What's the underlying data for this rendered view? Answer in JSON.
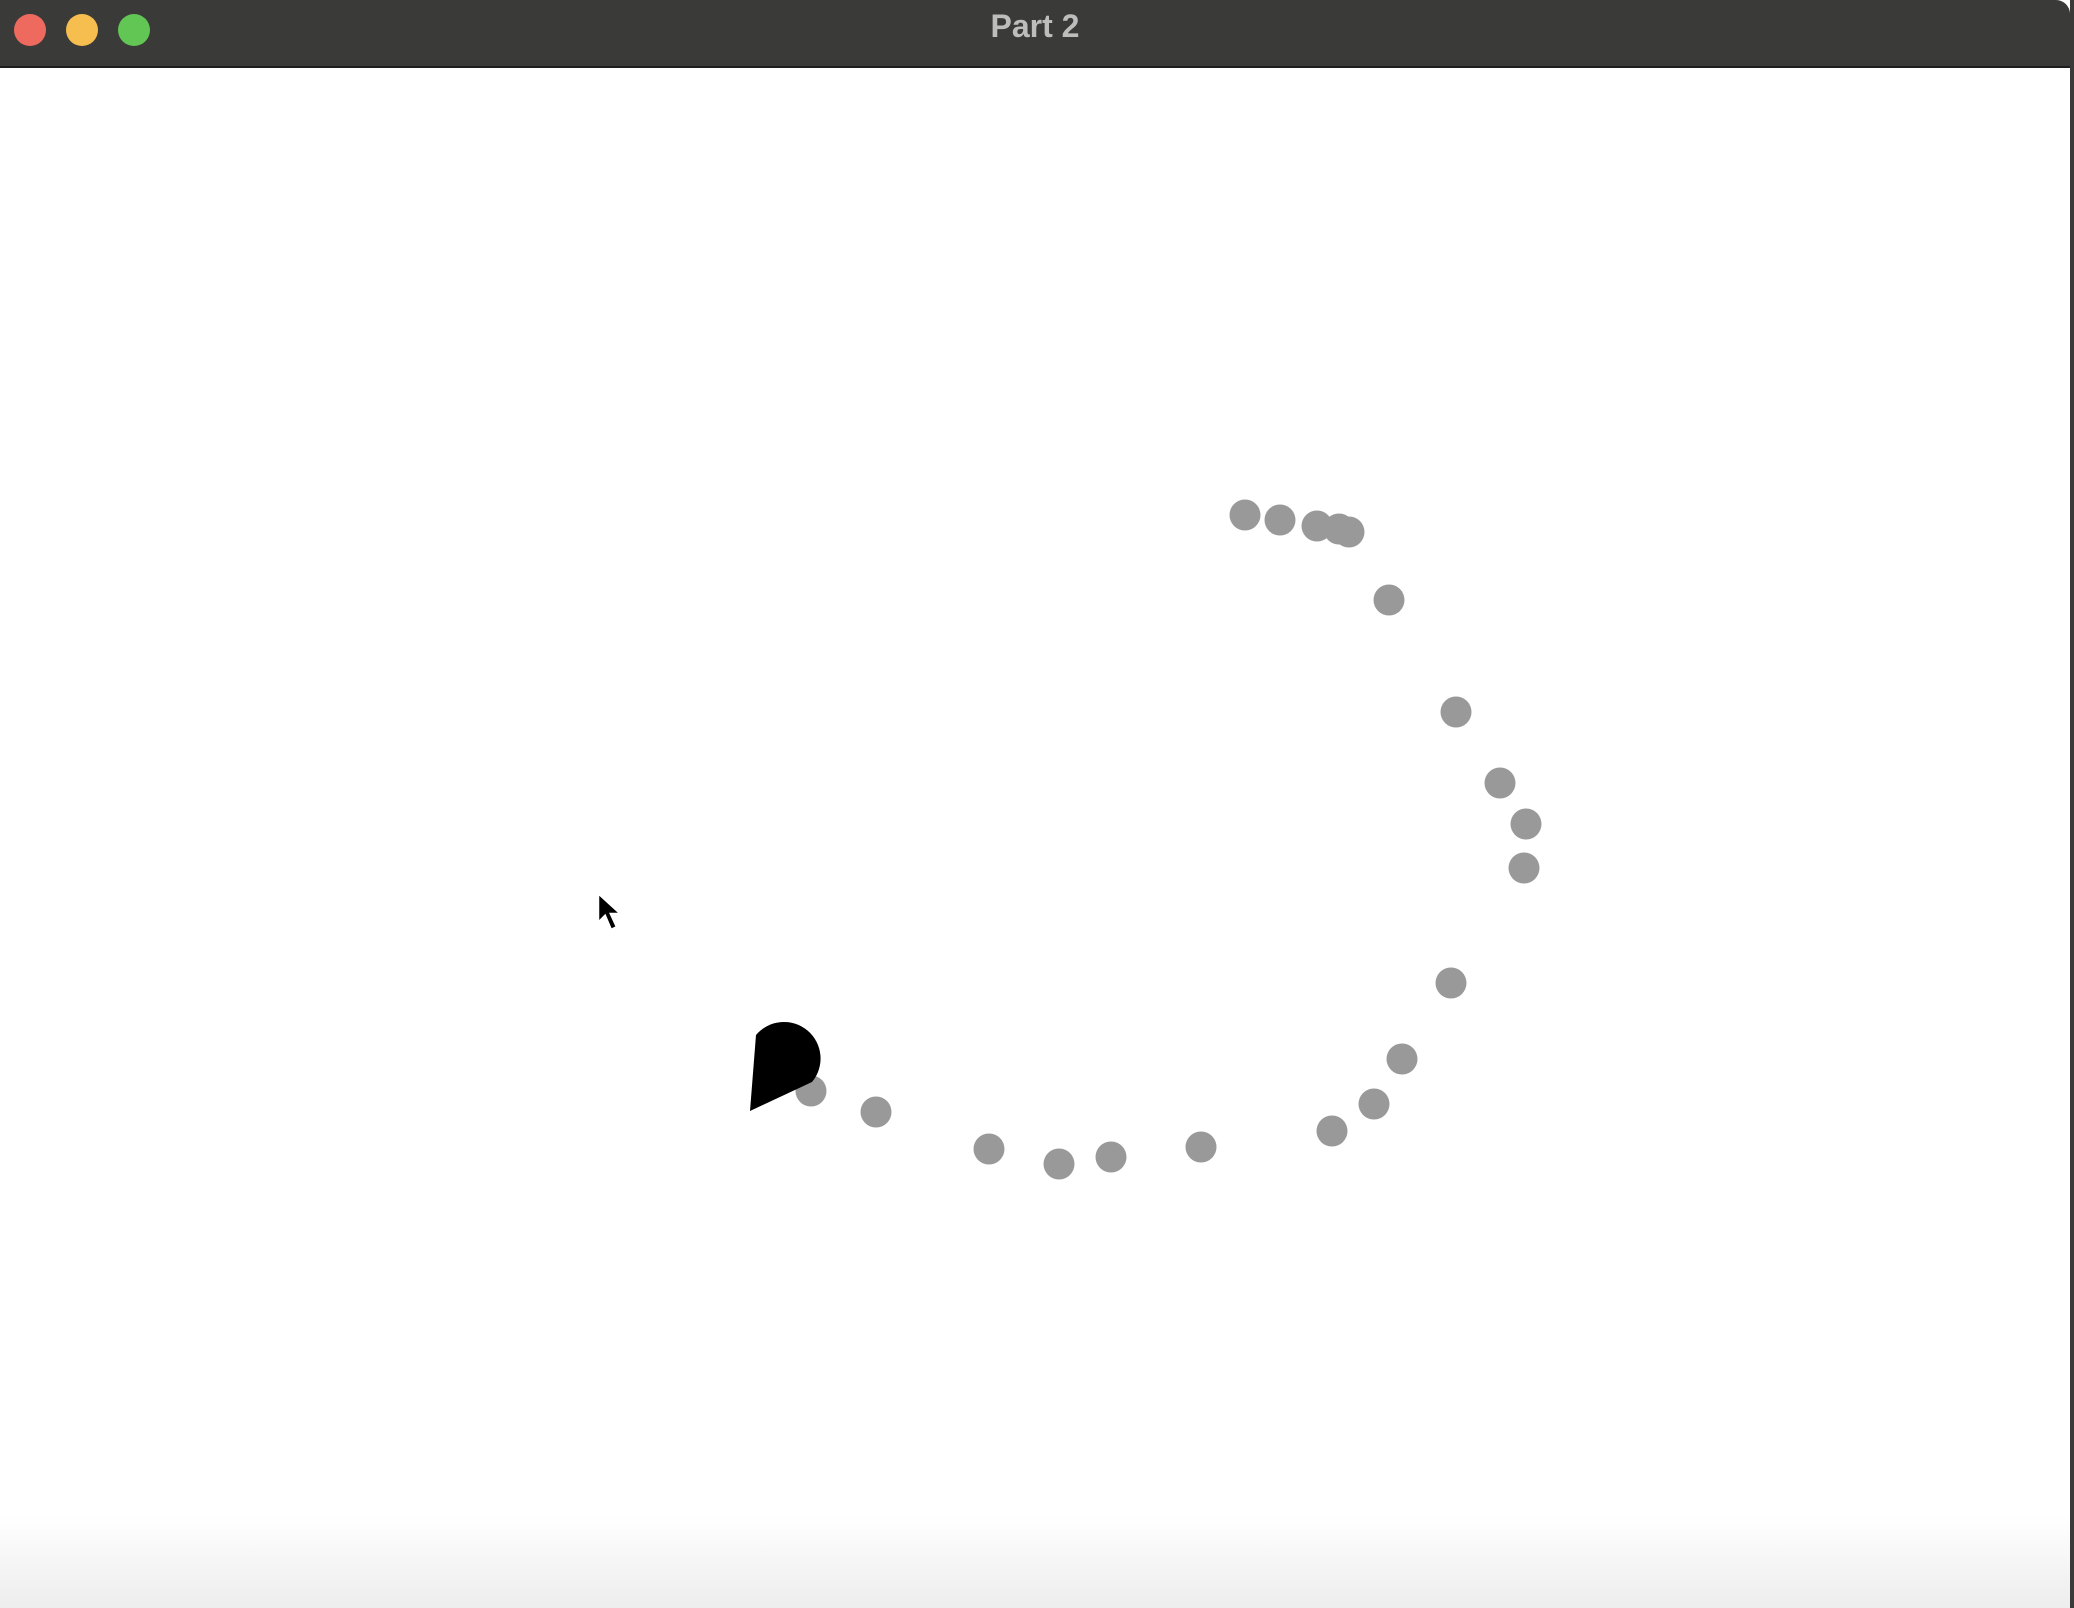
{
  "window": {
    "title": "Part 2"
  },
  "colors": {
    "trail_dot": "#999999",
    "player": "#000000",
    "titlebar": "#3a3a38",
    "close": "#ee6a5f",
    "minimize": "#f5be4f",
    "maximize": "#62c655"
  },
  "game": {
    "trail_dot_count": 20
  }
}
